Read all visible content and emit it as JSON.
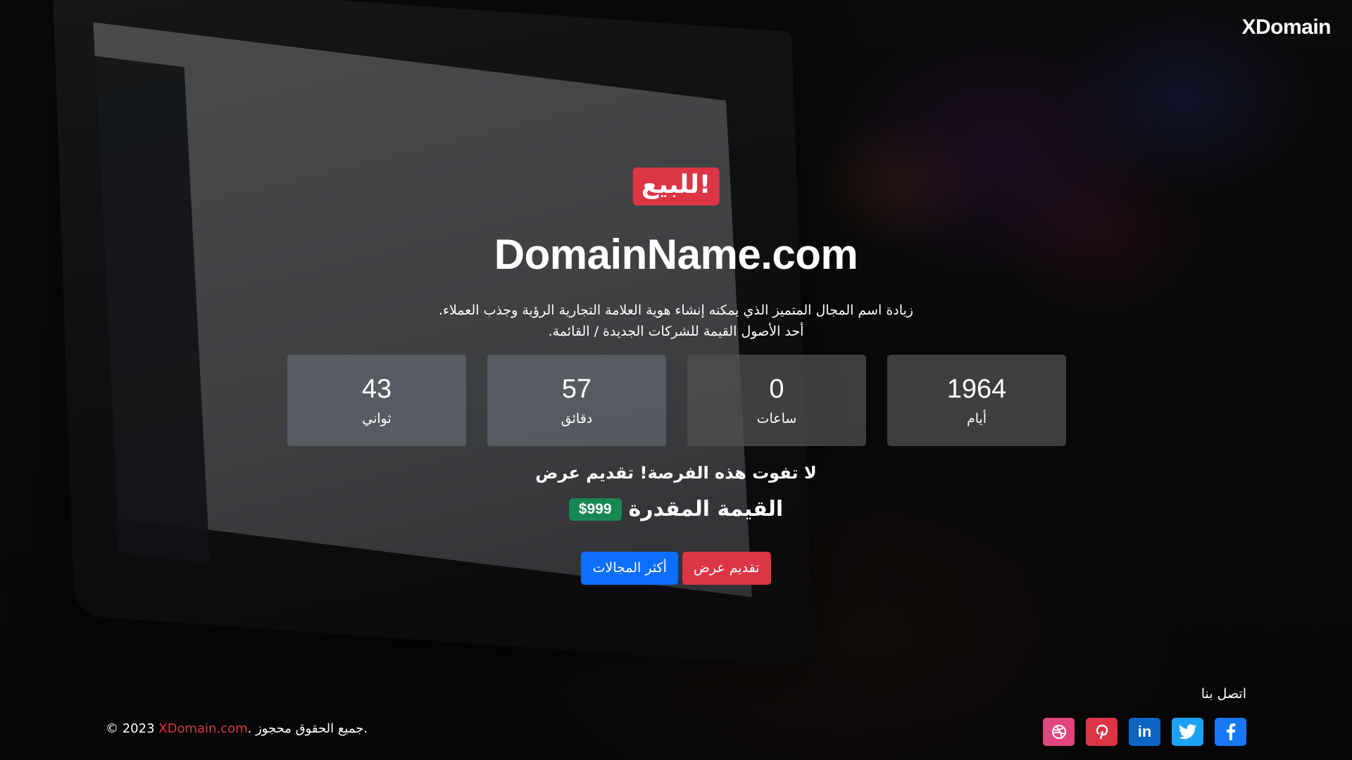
{
  "brand": "XDomain",
  "badge": "للبيع!",
  "domain": "DomainName.com",
  "description": [
    "زيادة اسم المجال المتميز الذي يمكنه إنشاء هوية العلامة التجارية الرؤية وجذب العملاء.",
    "أحد الأصول القيمة للشركات الجديدة / القائمة."
  ],
  "countdown": [
    {
      "value": "43",
      "label": "ثواني"
    },
    {
      "value": "57",
      "label": "دقائق"
    },
    {
      "value": "0",
      "label": "ساعات"
    },
    {
      "value": "1964",
      "label": "أيام"
    }
  ],
  "cta": "لا تفوت هذه الفرصة! تقديم عرض",
  "estimated_value": {
    "label": "القيمة المقدرة",
    "price": "$999"
  },
  "buttons": {
    "offer": "تقديم عرض",
    "more_domains": "أكثر المجالات"
  },
  "footer": {
    "contact_label": "اتصل بنا",
    "copyright_prefix": "© 2023 ",
    "copyright_link": "XDomain.com",
    "copyright_suffix": ". جميع الحقوق محجوز."
  },
  "socials": [
    {
      "icon": "dribbble-icon",
      "color": "#e1457e"
    },
    {
      "icon": "pinterest-icon",
      "color": "#dc3545"
    },
    {
      "icon": "linkedin-icon",
      "color": "#0a66c2"
    },
    {
      "icon": "twitter-icon",
      "color": "#1da1f2"
    },
    {
      "icon": "facebook-icon",
      "color": "#1877f2"
    }
  ]
}
